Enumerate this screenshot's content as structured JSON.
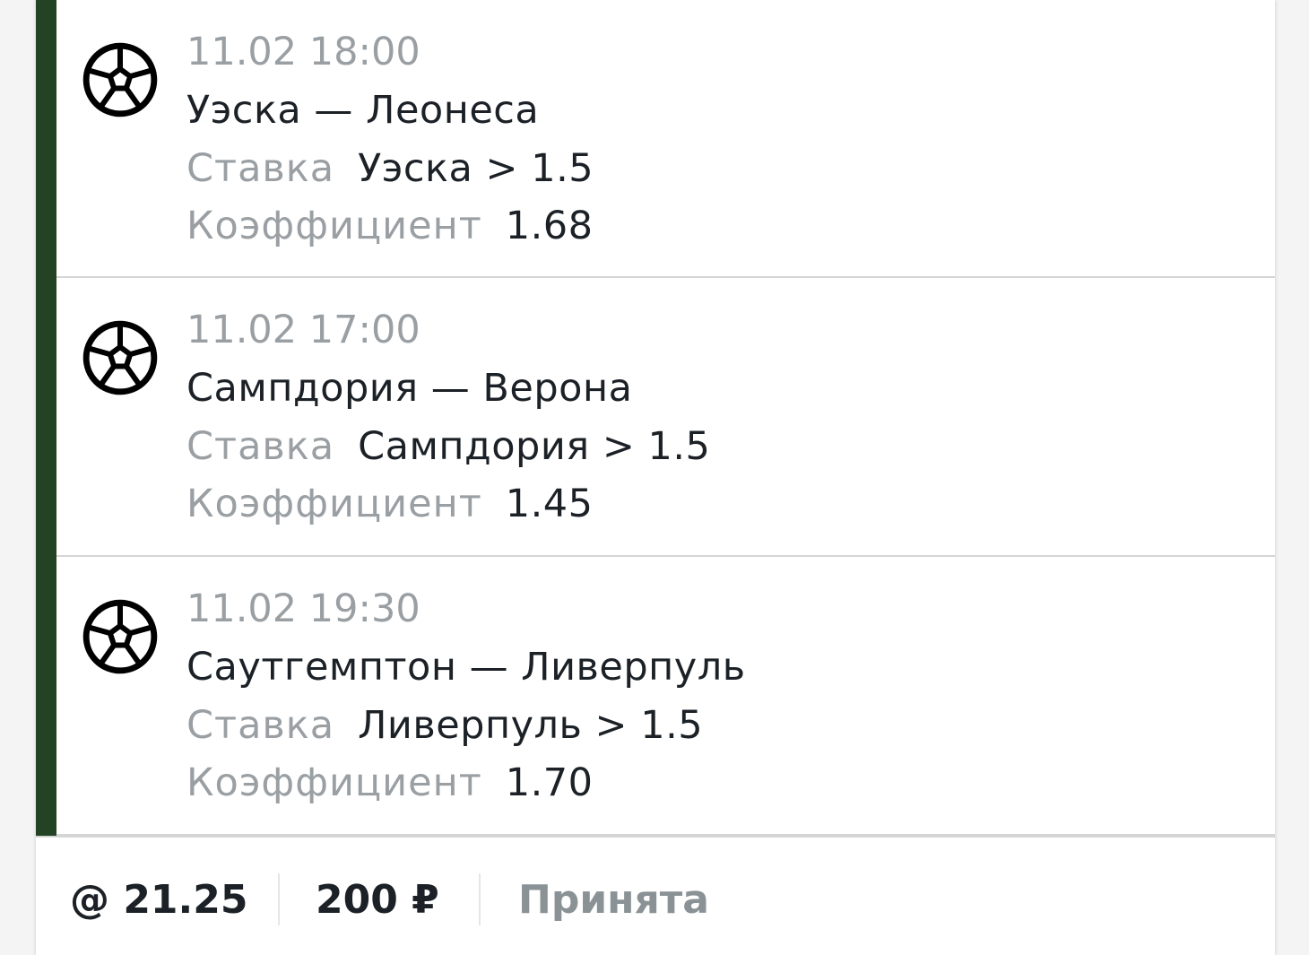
{
  "events": [
    {
      "datetime": "11.02 18:00",
      "teams": "Уэска — Леонеса",
      "bet_label": "Ставка",
      "bet_value": "Уэска > 1.5",
      "coef_label": "Коэффициент",
      "coef_value": "1.68",
      "icon": "soccer-ball-icon"
    },
    {
      "datetime": "11.02 17:00",
      "teams": "Сампдория — Верона",
      "bet_label": "Ставка",
      "bet_value": "Сампдория > 1.5",
      "coef_label": "Коэффициент",
      "coef_value": "1.45",
      "icon": "soccer-ball-icon"
    },
    {
      "datetime": "11.02 19:30",
      "teams": "Саутгемптон — Ливерпуль",
      "bet_label": "Ставка",
      "bet_value": "Ливерпуль > 1.5",
      "coef_label": "Коэффициент",
      "coef_value": "1.70",
      "icon": "soccer-ball-icon"
    }
  ],
  "summary": {
    "total_odds": "@ 21.25",
    "stake": "200 ₽",
    "status": "Принята"
  },
  "colors": {
    "accent": "#234324",
    "text_primary": "#1b2126",
    "text_secondary": "#9a9fa3",
    "status": "#8a9296"
  }
}
